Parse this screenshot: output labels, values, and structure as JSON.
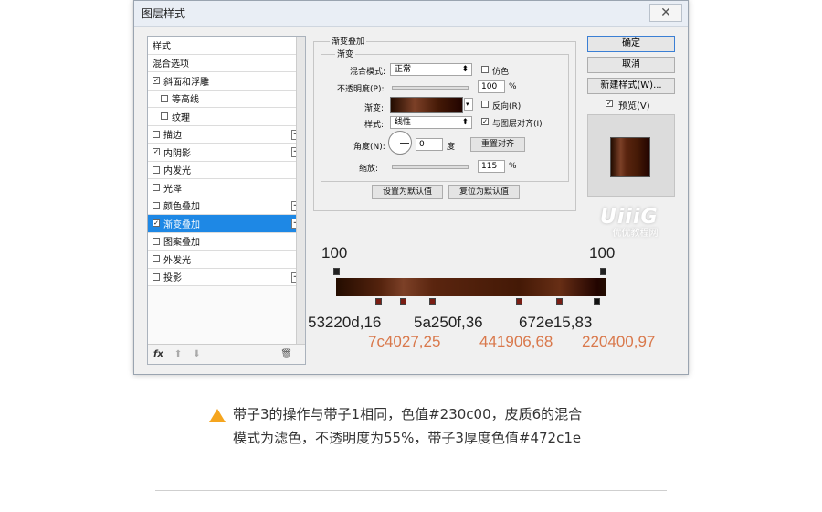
{
  "dialog": {
    "title": "图层样式",
    "close": "✕",
    "style_list": [
      {
        "label": "样式",
        "check": false,
        "sub": false,
        "plus": false,
        "active": false,
        "has_cb": false
      },
      {
        "label": "混合选项",
        "check": false,
        "sub": false,
        "plus": false,
        "active": false,
        "has_cb": false
      },
      {
        "label": "斜面和浮雕",
        "check": true,
        "sub": false,
        "plus": false,
        "active": false,
        "has_cb": true
      },
      {
        "label": "等高线",
        "check": false,
        "sub": true,
        "plus": false,
        "active": false,
        "has_cb": true
      },
      {
        "label": "纹理",
        "check": false,
        "sub": true,
        "plus": false,
        "active": false,
        "has_cb": true
      },
      {
        "label": "描边",
        "check": false,
        "sub": false,
        "plus": true,
        "active": false,
        "has_cb": true
      },
      {
        "label": "内阴影",
        "check": true,
        "sub": false,
        "plus": true,
        "active": false,
        "has_cb": true
      },
      {
        "label": "内发光",
        "check": false,
        "sub": false,
        "plus": false,
        "active": false,
        "has_cb": true
      },
      {
        "label": "光泽",
        "check": false,
        "sub": false,
        "plus": false,
        "active": false,
        "has_cb": true
      },
      {
        "label": "颜色叠加",
        "check": false,
        "sub": false,
        "plus": true,
        "active": false,
        "has_cb": true
      },
      {
        "label": "渐变叠加",
        "check": true,
        "sub": false,
        "plus": true,
        "active": true,
        "has_cb": true
      },
      {
        "label": "图案叠加",
        "check": false,
        "sub": false,
        "plus": false,
        "active": false,
        "has_cb": true
      },
      {
        "label": "外发光",
        "check": false,
        "sub": false,
        "plus": false,
        "active": false,
        "has_cb": true
      },
      {
        "label": "投影",
        "check": false,
        "sub": false,
        "plus": true,
        "active": false,
        "has_cb": true
      }
    ],
    "list_footer": {
      "fx": "fx",
      "up": "⬆",
      "down": "⬇",
      "trash": "🗑"
    },
    "panel": {
      "group_title": "渐变叠加",
      "sub_title": "渐变",
      "blend_mode_label": "混合模式:",
      "blend_mode_value": "正常",
      "dither_label": "仿色",
      "opacity_label": "不透明度(P):",
      "opacity_value": "100",
      "percent": "%",
      "gradient_label": "渐变:",
      "reverse_label": "反向(R)",
      "style_label": "样式:",
      "style_value": "线性",
      "align_label": "与图层对齐(I)",
      "angle_label": "角度(N):",
      "angle_value": "0",
      "degree": "度",
      "reset_align": "重置对齐",
      "scale_label": "缩放:",
      "scale_value": "115",
      "set_default": "设置为默认值",
      "reset_default": "复位为默认值"
    },
    "buttons": {
      "ok": "确定",
      "cancel": "取消",
      "new_style": "新建样式(W)...",
      "preview": "预览(V)"
    }
  },
  "watermark": {
    "line1": "UiiiG",
    "line2": "优优教程网"
  },
  "gradient_annotations": {
    "top_left": "100",
    "top_right": "100",
    "row1": [
      "53220d,16",
      "5a250f,36",
      "672e15,83"
    ],
    "row2": [
      "7c4027,25",
      "441906,68",
      "220400,97"
    ]
  },
  "note": {
    "line1": "带子3的操作与带子1相同，色值#230c00，皮质6的混合",
    "line2": "模式为滤色，不透明度为55%，带子3厚度色值#472c1e"
  },
  "colors": {
    "accent": "#1e88e5",
    "annotation_orange": "#d9784b",
    "warning": "#f5a51e"
  }
}
